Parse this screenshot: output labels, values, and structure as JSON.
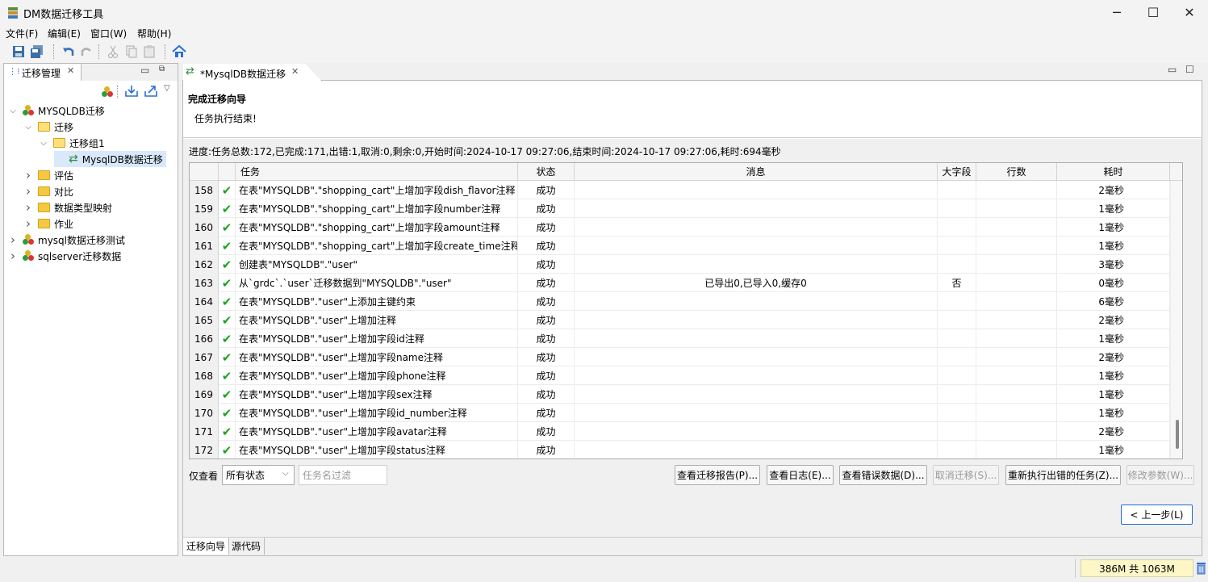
{
  "window": {
    "title": "DM数据迁移工具"
  },
  "menu": [
    "文件(F)",
    "编辑(E)",
    "窗口(W)",
    "帮助(H)"
  ],
  "left_panel": {
    "tab_label": "迁移管理",
    "tree": [
      {
        "label": "MYSQLDB迁移",
        "level": 0,
        "expanded": true,
        "icon": "db-icon"
      },
      {
        "label": "迁移",
        "level": 1,
        "expanded": true,
        "icon": "folder-icon"
      },
      {
        "label": "迁移组1",
        "level": 2,
        "expanded": true,
        "icon": "folder-icon"
      },
      {
        "label": "MysqlDB数据迁移",
        "level": 3,
        "icon": "migration-icon",
        "selected": true
      },
      {
        "label": "评估",
        "level": 1,
        "expanded": false,
        "icon": "folder-icon"
      },
      {
        "label": "对比",
        "level": 1,
        "expanded": false,
        "icon": "folder-icon"
      },
      {
        "label": "数据类型映射",
        "level": 1,
        "expanded": false,
        "icon": "folder-icon"
      },
      {
        "label": "作业",
        "level": 1,
        "expanded": false,
        "icon": "folder-icon"
      },
      {
        "label": "mysql数据迁移测试",
        "level": 0,
        "expanded": false,
        "icon": "db-icon"
      },
      {
        "label": "sqlserver迁移数据",
        "level": 0,
        "expanded": false,
        "icon": "db-icon"
      }
    ]
  },
  "editor": {
    "tab_label": "*MysqlDB数据迁移",
    "wizard_title": "完成迁移向导",
    "wizard_subtitle": "任务执行结束!",
    "progress_text": "进度:任务总数:172,已完成:171,出错:1,取消:0,剩余:0,开始时间:2024-10-17 09:27:06,结束时间:2024-10-17 09:27:06,耗时:694毫秒",
    "table": {
      "headers": [
        "",
        "",
        "任务",
        "状态",
        "消息",
        "大字段",
        "行数",
        "耗时"
      ],
      "rows": [
        {
          "num": "158",
          "task": "在表\"MYSQLDB\".\"shopping_cart\"上增加字段dish_flavor注释",
          "status": "成功",
          "message": "",
          "lob": "",
          "rows": "",
          "time": "2毫秒"
        },
        {
          "num": "159",
          "task": "在表\"MYSQLDB\".\"shopping_cart\"上增加字段number注释",
          "status": "成功",
          "message": "",
          "lob": "",
          "rows": "",
          "time": "1毫秒"
        },
        {
          "num": "160",
          "task": "在表\"MYSQLDB\".\"shopping_cart\"上增加字段amount注释",
          "status": "成功",
          "message": "",
          "lob": "",
          "rows": "",
          "time": "1毫秒"
        },
        {
          "num": "161",
          "task": "在表\"MYSQLDB\".\"shopping_cart\"上增加字段create_time注释",
          "status": "成功",
          "message": "",
          "lob": "",
          "rows": "",
          "time": "1毫秒"
        },
        {
          "num": "162",
          "task": "创建表\"MYSQLDB\".\"user\"",
          "status": "成功",
          "message": "",
          "lob": "",
          "rows": "",
          "time": "3毫秒"
        },
        {
          "num": "163",
          "task": "从`grdc`.`user`迁移数据到\"MYSQLDB\".\"user\"",
          "status": "成功",
          "message": "已导出0,已导入0,缓存0",
          "lob": "否",
          "rows": "",
          "time": "0毫秒"
        },
        {
          "num": "164",
          "task": "在表\"MYSQLDB\".\"user\"上添加主键约束",
          "status": "成功",
          "message": "",
          "lob": "",
          "rows": "",
          "time": "6毫秒"
        },
        {
          "num": "165",
          "task": "在表\"MYSQLDB\".\"user\"上增加注释",
          "status": "成功",
          "message": "",
          "lob": "",
          "rows": "",
          "time": "2毫秒"
        },
        {
          "num": "166",
          "task": "在表\"MYSQLDB\".\"user\"上增加字段id注释",
          "status": "成功",
          "message": "",
          "lob": "",
          "rows": "",
          "time": "1毫秒"
        },
        {
          "num": "167",
          "task": "在表\"MYSQLDB\".\"user\"上增加字段name注释",
          "status": "成功",
          "message": "",
          "lob": "",
          "rows": "",
          "time": "2毫秒"
        },
        {
          "num": "168",
          "task": "在表\"MYSQLDB\".\"user\"上增加字段phone注释",
          "status": "成功",
          "message": "",
          "lob": "",
          "rows": "",
          "time": "1毫秒"
        },
        {
          "num": "169",
          "task": "在表\"MYSQLDB\".\"user\"上增加字段sex注释",
          "status": "成功",
          "message": "",
          "lob": "",
          "rows": "",
          "time": "1毫秒"
        },
        {
          "num": "170",
          "task": "在表\"MYSQLDB\".\"user\"上增加字段id_number注释",
          "status": "成功",
          "message": "",
          "lob": "",
          "rows": "",
          "time": "1毫秒"
        },
        {
          "num": "171",
          "task": "在表\"MYSQLDB\".\"user\"上增加字段avatar注释",
          "status": "成功",
          "message": "",
          "lob": "",
          "rows": "",
          "time": "2毫秒"
        },
        {
          "num": "172",
          "task": "在表\"MYSQLDB\".\"user\"上增加字段status注释",
          "status": "成功",
          "message": "",
          "lob": "",
          "rows": "",
          "time": "1毫秒"
        }
      ]
    },
    "filter": {
      "label": "仅查看",
      "status_selected": "所有状态",
      "name_placeholder": "任务名过滤"
    },
    "buttons": {
      "report": "查看迁移报告(P)...",
      "log": "查看日志(E)...",
      "errors": "查看错误数据(D)...",
      "cancel": "取消迁移(S)...",
      "rerun": "重新执行出错的任务(Z)...",
      "params": "修改参数(W)...",
      "prev": "< 上一步(L)"
    },
    "bottom_tabs": [
      "迁移向导",
      "源代码"
    ]
  },
  "status": {
    "memory": "386M 共 1063M"
  },
  "colors": {
    "accent": "#1e6bd6",
    "success": "#1fa31f",
    "selection": "#d9e8fb",
    "memory_bg": "#fdf7c8"
  }
}
